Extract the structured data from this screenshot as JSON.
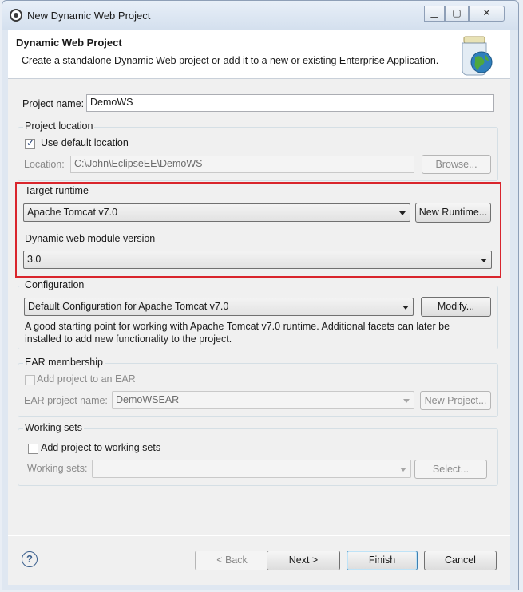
{
  "window": {
    "title": "New Dynamic Web Project",
    "controls": {
      "minimize": "▁",
      "maximize": "▢",
      "close": "✕"
    }
  },
  "banner": {
    "title": "Dynamic Web Project",
    "description": "Create a standalone Dynamic Web project or add it to a new or existing Enterprise Application.",
    "icon": "globe-jar-icon"
  },
  "project_name": {
    "label": "Project name:",
    "value": "DemoWS"
  },
  "project_location": {
    "group_label": "Project location",
    "use_default_label": "Use default location",
    "use_default_checked": true,
    "location_label": "Location:",
    "location_value": "C:\\John\\EclipseEE\\DemoWS",
    "browse_label": "Browse..."
  },
  "target_runtime": {
    "group_label": "Target runtime",
    "value": "Apache Tomcat v7.0",
    "new_runtime_label": "New Runtime..."
  },
  "module_version": {
    "group_label": "Dynamic web module version",
    "value": "3.0"
  },
  "configuration": {
    "group_label": "Configuration",
    "value": "Default Configuration for Apache Tomcat v7.0",
    "modify_label": "Modify...",
    "description_line1": "A good starting point for working with Apache Tomcat v7.0 runtime. Additional facets can later be",
    "description_line2": "installed to add new functionality to the project."
  },
  "ear": {
    "group_label": "EAR membership",
    "add_label": "Add project to an EAR",
    "project_name_label": "EAR project name:",
    "project_name_value": "DemoWSEAR",
    "new_project_label": "New Project..."
  },
  "working_sets": {
    "group_label": "Working sets",
    "add_label": "Add project to working sets",
    "sets_label": "Working sets:",
    "sets_value": "",
    "select_label": "Select..."
  },
  "footer": {
    "help_label": "?",
    "back_label": "< Back",
    "next_label": "Next >",
    "finish_label": "Finish",
    "cancel_label": "Cancel"
  },
  "colors": {
    "highlight_box": "#d9252c",
    "accent": "#3c7fb1"
  }
}
